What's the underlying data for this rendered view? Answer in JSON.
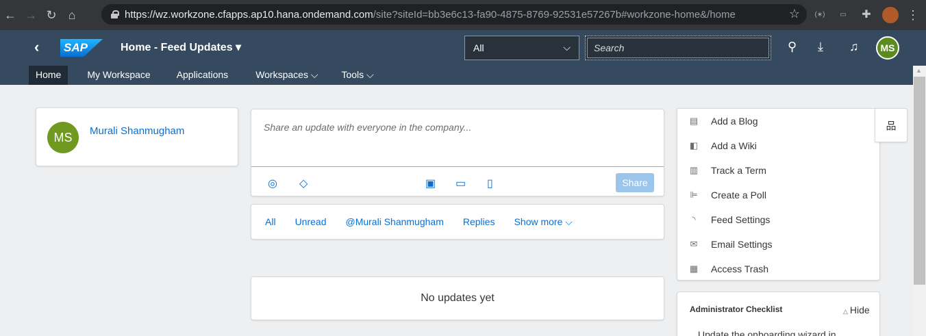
{
  "browser": {
    "url_host": "https://wz.workzone.cfapps.ap10.hana.ondemand.com",
    "url_path": "/site?siteId=bb3e6c13-fa90-4875-8769-92531e57267b#workzone-home&/home"
  },
  "shell": {
    "logo": "SAP",
    "title": "Home - Feed Updates ▾",
    "scope_value": "All",
    "search_placeholder": "Search",
    "user_initials": "MS"
  },
  "nav": {
    "tabs": [
      {
        "label": "Home",
        "active": true
      },
      {
        "label": "My Workspace",
        "active": false
      },
      {
        "label": "Applications",
        "active": false
      },
      {
        "label": "Workspaces ⌵",
        "active": false
      },
      {
        "label": "Tools ⌵",
        "active": false
      }
    ]
  },
  "profile": {
    "initials": "MS",
    "name": "Murali Shanmugham"
  },
  "share": {
    "placeholder": "Share an update with everyone in the company...",
    "button": "Share"
  },
  "filters": {
    "items": [
      "All",
      "Unread",
      "@Murali Shanmugham",
      "Replies",
      "Show more ⌵"
    ]
  },
  "feed": {
    "empty_message": "No updates yet"
  },
  "actions": {
    "items": [
      {
        "label": "Add a Blog",
        "icon": "blog-icon"
      },
      {
        "label": "Add a Wiki",
        "icon": "wiki-icon"
      },
      {
        "label": "Track a Term",
        "icon": "track-term-icon"
      },
      {
        "label": "Create a Poll",
        "icon": "poll-icon"
      },
      {
        "label": "Feed Settings",
        "icon": "feed-icon"
      },
      {
        "label": "Email Settings",
        "icon": "email-icon"
      },
      {
        "label": "Access Trash",
        "icon": "trash-icon"
      }
    ]
  },
  "checklist": {
    "title": "Administrator Checklist",
    "hide_label": "Hide",
    "first_item": "Update the onboarding wizard in"
  },
  "colors": {
    "shell": "#354a5f",
    "link": "#0a6ed1",
    "avatar": "#6f9a1f"
  }
}
